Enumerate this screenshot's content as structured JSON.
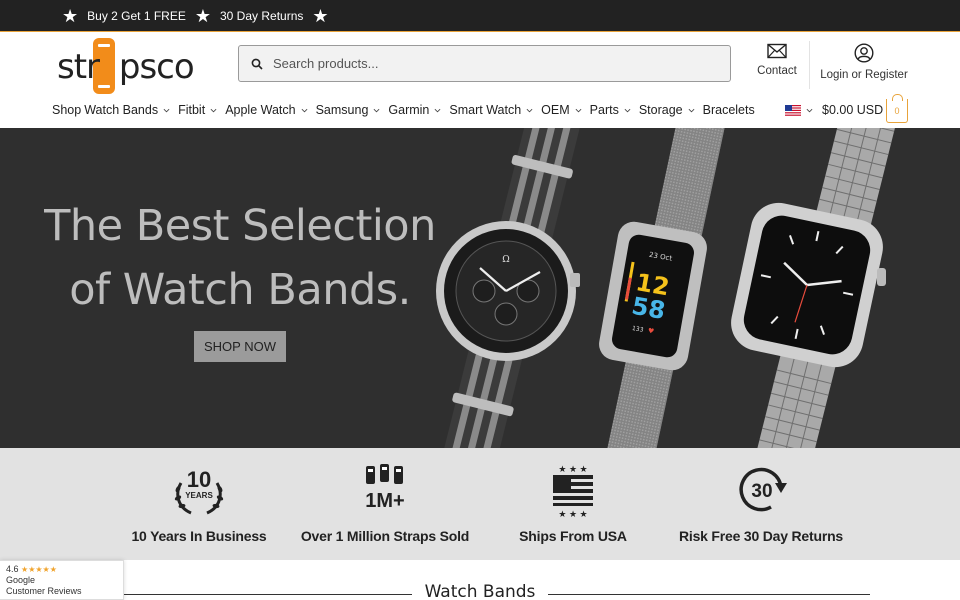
{
  "promo": {
    "messages": [
      "Buy 2 Get 1 FREE",
      "30 Day Returns"
    ]
  },
  "header": {
    "logo_text": "strapsco",
    "search_placeholder": "Search products...",
    "contact_label": "Contact",
    "account_label": "Login or Register",
    "currency_label": "$0.00 USD",
    "cart_count": "0"
  },
  "nav": {
    "items": [
      "Shop",
      "Watch Bands",
      "Fitbit",
      "Apple Watch",
      "Samsung",
      "Garmin",
      "Smart Watch",
      "OEM",
      "Parts",
      "Storage",
      "Bracelets"
    ]
  },
  "hero": {
    "headline_line1": "The Best Selection",
    "headline_line2": "of Watch Bands.",
    "cta_label": "SHOP NOW",
    "fitbit_date": "23 Oct",
    "fitbit_hour": "12",
    "fitbit_minute": "58",
    "fitbit_bpm": "133"
  },
  "features": [
    {
      "label": "10 Years In Business",
      "icon": "laurel-10-years-icon",
      "badge_big": "10",
      "badge_small": "YEARS"
    },
    {
      "label": "Over 1 Million Straps Sold",
      "icon": "straps-sold-icon",
      "badge_big": "1M+"
    },
    {
      "label": "Ships From USA",
      "icon": "usa-flag-icon"
    },
    {
      "label": "Risk Free 30 Day Returns",
      "icon": "return-30-icon",
      "badge_big": "30"
    }
  ],
  "reviews": {
    "rating": "4.6",
    "stars": "★★★★★",
    "line1": "Google",
    "line2": "Customer Reviews"
  },
  "section": {
    "title": "Watch Bands"
  },
  "colors": {
    "accent": "#e8a33a",
    "logo_orange": "#f28c1a",
    "promo_bg": "#222222",
    "hero_bg": "#2f2f2f",
    "features_bg": "#e2e2e2"
  }
}
